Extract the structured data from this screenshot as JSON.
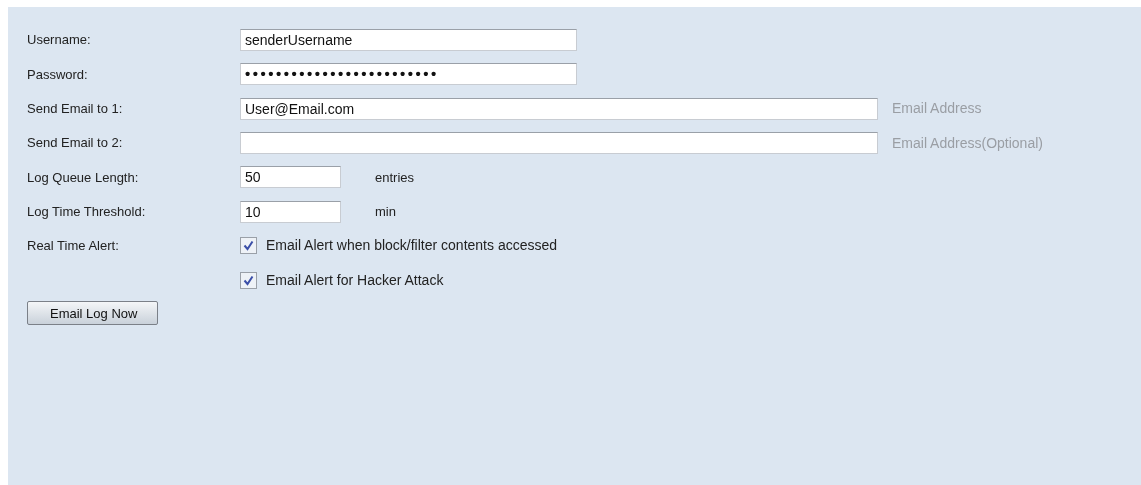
{
  "fields": [
    {
      "kind": "text",
      "label": "Username:",
      "value": "senderUsername"
    },
    {
      "kind": "text",
      "label": "Password:",
      "value": "•••••••••••••••••••••••••",
      "masked": true
    },
    {
      "kind": "text",
      "label": "Send Email to 1:",
      "value": "User@Email.com",
      "hint": "Email Address"
    },
    {
      "kind": "text",
      "label": "Send Email to 2:",
      "hint": "Email Address(Optional)"
    },
    {
      "kind": "text",
      "label": "Log Queue Length:",
      "value": "50",
      "unit": "entries"
    },
    {
      "kind": "text",
      "label": "Log Time Threshold:",
      "value": "10",
      "unit": "min"
    },
    {
      "kind": "checks",
      "label": "Real Time Alert:",
      "options": [
        {
          "label": "Email Alert when block/filter contents accessed",
          "checked": true
        },
        {
          "label": "Email Alert for Hacker Attack",
          "checked": true
        }
      ]
    }
  ],
  "button": "Email Log Now"
}
